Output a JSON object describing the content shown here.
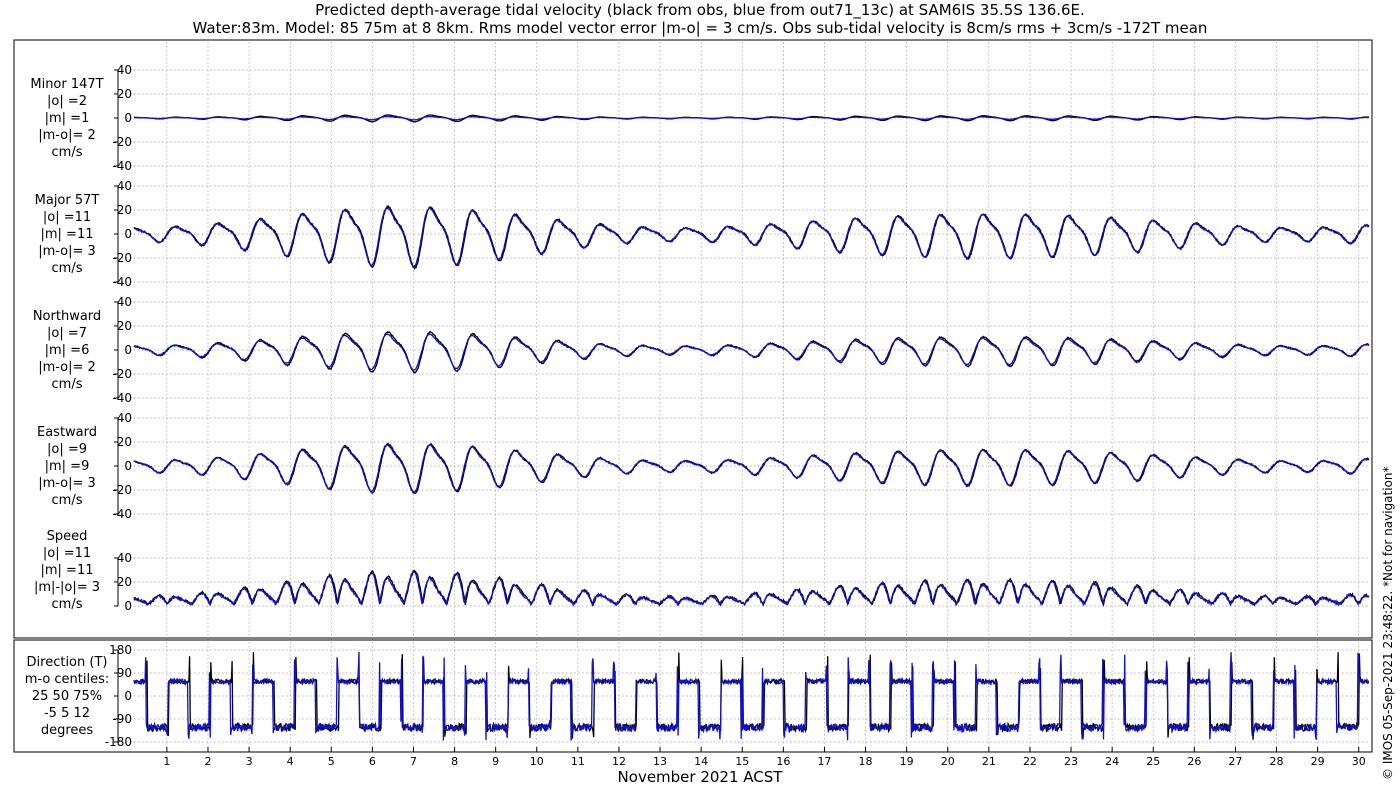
{
  "header": {
    "title_line1": "Predicted depth-average tidal velocity (black from obs, blue from out71_13c) at SAM6IS 35.5S 136.6E.",
    "title_line2": "Water:83m. Model: 85 75m at 8 8km. Rms model vector error |m-o| = 3 cm/s. Obs sub-tidal velocity is 8cm/s rms + 3cm/s -172T mean"
  },
  "footnote": "© IMOS 05-Sep-2021 23:48:22. *Not for navigation*",
  "colors": {
    "obs": "#000000",
    "model": "#1010cc",
    "grid": "#9a9a9a"
  },
  "chart_data": {
    "type": "line",
    "xlabel": "November 2021 ACST",
    "x_ticks": [
      "1",
      "2",
      "3",
      "4",
      "5",
      "6",
      "7",
      "8",
      "9",
      "10",
      "11",
      "12",
      "13",
      "14",
      "15",
      "16",
      "17",
      "18",
      "19",
      "20",
      "21",
      "22",
      "23",
      "24",
      "25",
      "26",
      "27",
      "28",
      "29",
      "30"
    ],
    "xlim": [
      0.2,
      30.25
    ],
    "grid": true,
    "series_colors": {
      "obs": "black",
      "model": "blue"
    },
    "panels": [
      {
        "id": "minor",
        "label_lines": [
          "Minor 147T",
          "|o| =2",
          "|m| =1",
          "|m-o|= 2",
          "cm/s"
        ],
        "ylim": [
          -40,
          40
        ],
        "yticks": [
          "-40",
          "-20",
          "0",
          "20",
          "40"
        ],
        "amp_obs": 3,
        "amp_model": 1.5,
        "kind": "vel"
      },
      {
        "id": "major",
        "label_lines": [
          "Major 57T",
          "|o| =11",
          "|m| =11",
          "|m-o|= 3",
          "cm/s"
        ],
        "ylim": [
          -40,
          40
        ],
        "yticks": [
          "-40",
          "-20",
          "0",
          "20",
          "40"
        ],
        "amp_obs": 27,
        "amp_model": 26,
        "kind": "vel"
      },
      {
        "id": "north",
        "label_lines": [
          "Northward",
          "|o| =7",
          "|m| =6",
          "|m-o|= 2",
          "cm/s"
        ],
        "ylim": [
          -40,
          40
        ],
        "yticks": [
          "-40",
          "-20",
          "0",
          "20",
          "40"
        ],
        "amp_obs": 18,
        "amp_model": 16,
        "kind": "vel"
      },
      {
        "id": "east",
        "label_lines": [
          "Eastward",
          "|o| =9",
          "|m| =9",
          "|m-o|= 3",
          "cm/s"
        ],
        "ylim": [
          -40,
          40
        ],
        "yticks": [
          "-40",
          "-20",
          "0",
          "20",
          "40"
        ],
        "amp_obs": 22,
        "amp_model": 21,
        "kind": "vel"
      },
      {
        "id": "speed",
        "label_lines": [
          "Speed",
          "|o| =11",
          "|m| =11",
          "|m|-|o|= 3",
          "cm/s"
        ],
        "ylim": [
          0,
          40
        ],
        "yticks": [
          "0",
          "20",
          "40"
        ],
        "amp_obs": 27,
        "amp_model": 26,
        "kind": "speed"
      },
      {
        "id": "direction",
        "label_lines": [
          "Direction (T)",
          "m-o centiles:",
          "25  50  75%",
          "-5   5  12",
          "degrees"
        ],
        "ylim": [
          -180,
          180
        ],
        "yticks": [
          "-180",
          "-90",
          "0",
          "90",
          "180"
        ],
        "kind": "direction"
      }
    ]
  }
}
